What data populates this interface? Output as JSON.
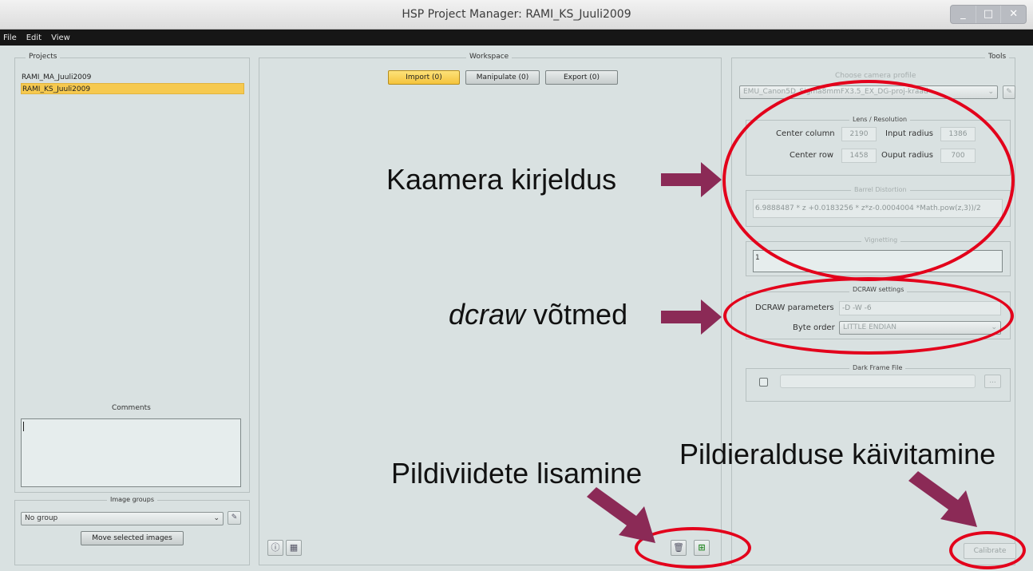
{
  "window": {
    "title": "HSP Project Manager: RAMI_KS_Juuli2009",
    "controls": [
      "_",
      "□",
      "✕"
    ]
  },
  "menu": [
    "File",
    "Edit",
    "View"
  ],
  "projects": {
    "title": "Projects",
    "items": [
      "RAMI_MA_Juuli2009",
      "RAMI_KS_Juuli2009"
    ],
    "selected_index": 1,
    "comments_label": "Comments",
    "comments_value": ""
  },
  "image_groups": {
    "title": "Image groups",
    "selected": "No group",
    "move_button": "Move selected images"
  },
  "workspace": {
    "title": "Workspace",
    "tabs": [
      "Import (0)",
      "Manipulate (0)",
      "Export (0)"
    ],
    "active_tab": 0
  },
  "tools": {
    "title": "Tools",
    "profile_label": "Choose camera profile",
    "profile_value": "EMU_Canon5D_Sigma8mmFX3.5_EX_DG-proj-kraad",
    "lens": {
      "title": "Lens / Resolution",
      "center_column_label": "Center column",
      "center_column": "2190",
      "input_radius_label": "Input radius",
      "input_radius": "1386",
      "center_row_label": "Center row",
      "center_row": "1458",
      "output_radius_label": "Ouput radius",
      "output_radius": "700"
    },
    "barrel": {
      "title": "Barrel Distortion",
      "value": "6.9888487 * z +0.0183256 * z*z-0.0004004 *Math.pow(z,3))/2"
    },
    "vignetting": {
      "title": "Vignetting",
      "value": "1"
    },
    "dcraw": {
      "title": "DCRAW settings",
      "params_label": "DCRAW parameters",
      "params_value": "-D -W -6",
      "byte_order_label": "Byte order",
      "byte_order_value": "LITTLE ENDIAN"
    },
    "dark_frame": {
      "title": "Dark Frame File",
      "browse_label": "...",
      "value": ""
    },
    "calibrate_button": "Calibrate"
  },
  "annotations": {
    "camera_description": "Kaamera kirjeldus",
    "dcraw_keys_italic": "dcraw",
    "dcraw_keys_rest": " võtmed",
    "adding_image_refs": "Pildiviidete lisamine",
    "start_separation": "Pildieralduse käivitamine"
  },
  "colors": {
    "annotation_red": "#e3001b",
    "arrow_purple": "#8b2a56",
    "selection_yellow": "#f6c94f"
  }
}
